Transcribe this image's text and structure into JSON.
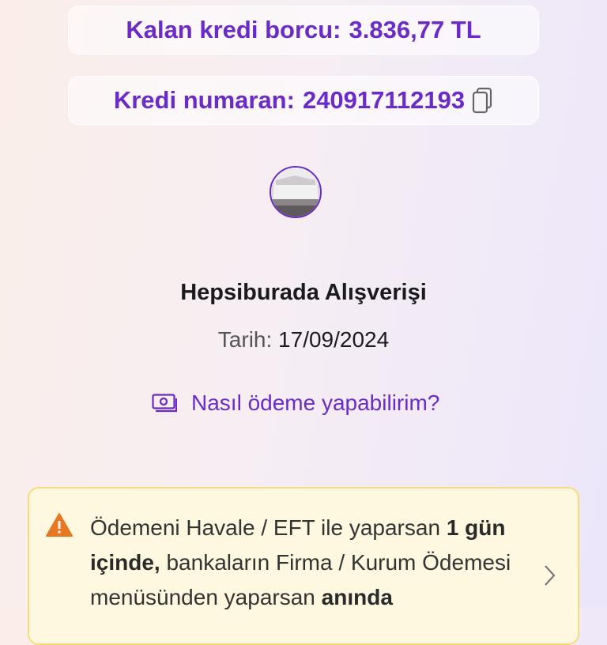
{
  "balance": {
    "label": "Kalan kredi borcu:",
    "value": "3.836,77 TL"
  },
  "loan": {
    "label": "Kredi numaran:",
    "value": "240917112193",
    "copy_icon": "copy-icon"
  },
  "purchase": {
    "avatar_icon": "bed-product-image",
    "merchant": "Hepsiburada Alışverişi",
    "date_label": "Tarih:",
    "date_value": "17/09/2024"
  },
  "howto": {
    "icon": "money-icon",
    "label": "Nasıl ödeme yapabilirim?"
  },
  "warning": {
    "icon": "warning-icon",
    "t1": "Ödemeni Havale / EFT ile yaparsan ",
    "b1": "1 gün içinde,",
    "t2": " bankaların Firma / Kurum Ödemesi menüsünden yaparsan ",
    "b2": "anında"
  },
  "colors": {
    "accent": "#6a2bc9",
    "warning": "#e87722",
    "warning_bg": "#fdf8df"
  }
}
